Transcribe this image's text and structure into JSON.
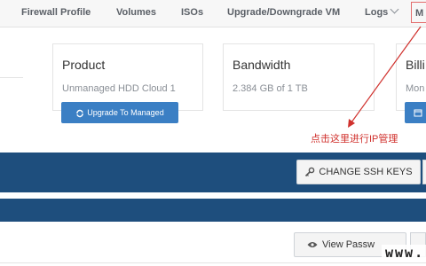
{
  "nav": {
    "firewall": "Firewall Profile",
    "volumes": "Volumes",
    "isos": "ISOs",
    "upgrade": "Upgrade/Downgrade VM",
    "logs": "Logs",
    "more": "M"
  },
  "cards": {
    "product": {
      "title": "Product",
      "value": "Unmanaged HDD Cloud 1",
      "button": "Upgrade To Managed"
    },
    "bandwidth": {
      "title": "Bandwidth",
      "value": "2.384 GB of 1 TB"
    },
    "billing": {
      "title": "Billi",
      "value": "Mon"
    }
  },
  "annotation": "点击这里进行IP管理",
  "actions": {
    "ssh_keys": "CHANGE SSH KEYS",
    "view_password": "View Passw"
  },
  "watermark": "www.",
  "colors": {
    "primary": "#3b7fc4",
    "navy_bar": "#1e4e7d",
    "annotation_red": "#d0312d"
  }
}
